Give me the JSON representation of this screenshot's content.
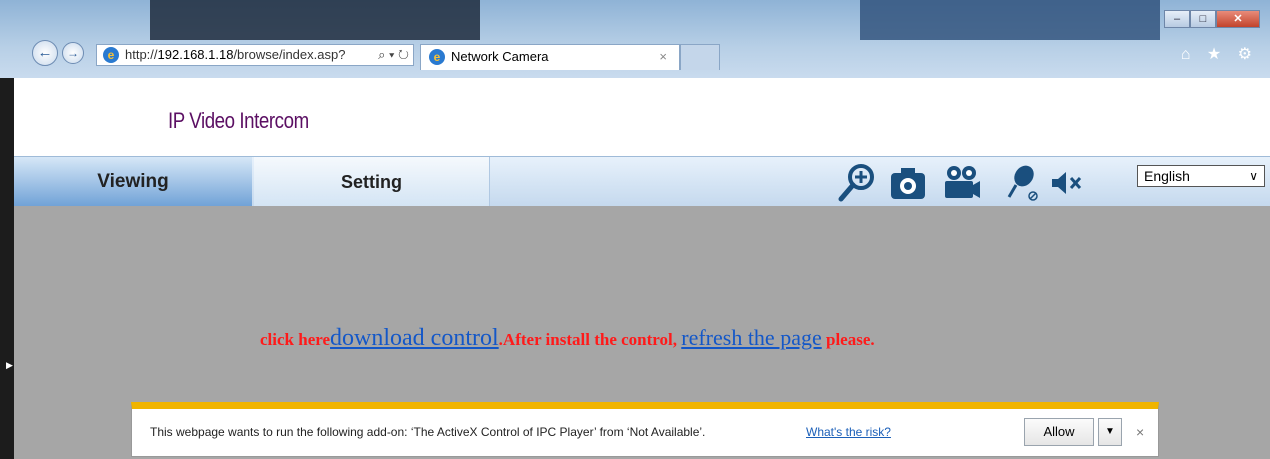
{
  "browser": {
    "address_prefix": "http://",
    "address_host": "192.168.1.18",
    "address_path": "/browse/index.asp?",
    "address_tools": "⌕ ▾ ↻",
    "tab_title": "Network Camera",
    "tab_close": "×",
    "right_tools": "⌂ ★ ⚙",
    "win_min": "–",
    "win_max": "□",
    "win_close": "✕"
  },
  "header": {
    "brand": "IP Video Intercom"
  },
  "nav": {
    "tabs": [
      {
        "label": "Viewing"
      },
      {
        "label": "Setting"
      }
    ],
    "tool_icons": [
      "zoom-in-icon",
      "snapshot-camera-icon",
      "video-record-icon",
      "microphone-icon",
      "speaker-mute-icon"
    ],
    "language": "English",
    "language_caret": "∨"
  },
  "viewer": {
    "prefix": "click here",
    "link1": "download control",
    "middle": ".After install the control, ",
    "link2": "refresh the page",
    "suffix": " please."
  },
  "notification": {
    "text": "This webpage wants to run the following add-on: ‘The ActiveX Control of IPC Player’ from ‘Not Available’.",
    "risk_link": "What's the risk?",
    "allow_label": "Allow",
    "dropdown": "▼",
    "close": "×"
  },
  "colors": {
    "brand": "#5b0f63",
    "message_red": "#ff1a1a",
    "link_blue": "#1357c8",
    "notify_accent": "#f0b400",
    "viewer_bg": "#a6a6a6"
  }
}
